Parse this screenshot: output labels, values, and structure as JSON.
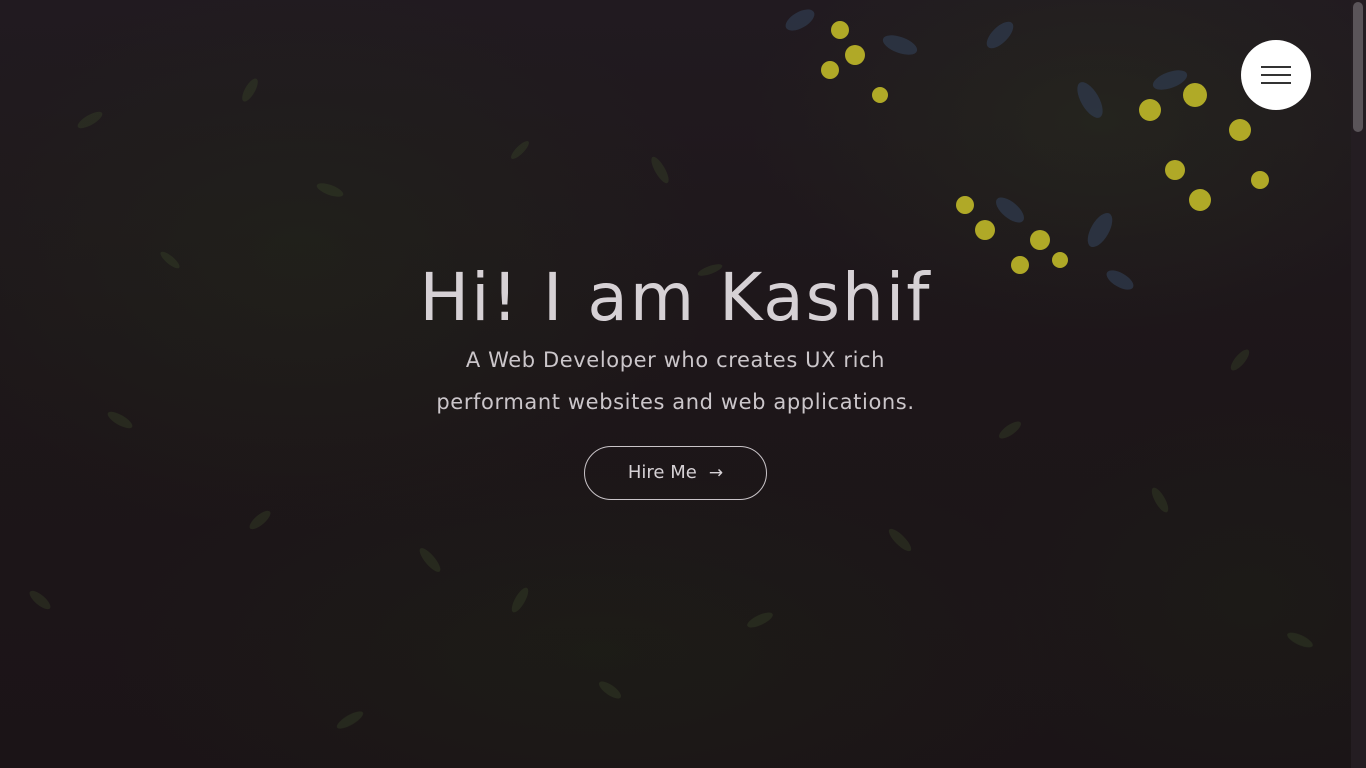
{
  "hero": {
    "title": "Hi! I am Kashif",
    "subtitle": "A Web Developer who creates UX rich performant websites and web applications.",
    "cta_label": "Hire Me",
    "cta_arrow": "→"
  },
  "menu": {
    "icon": "hamburger-icon"
  },
  "colors": {
    "background": "#1b1519",
    "text": "#d6d1d5",
    "menu_button": "#ffffff",
    "flowers": "#c9c22a"
  }
}
